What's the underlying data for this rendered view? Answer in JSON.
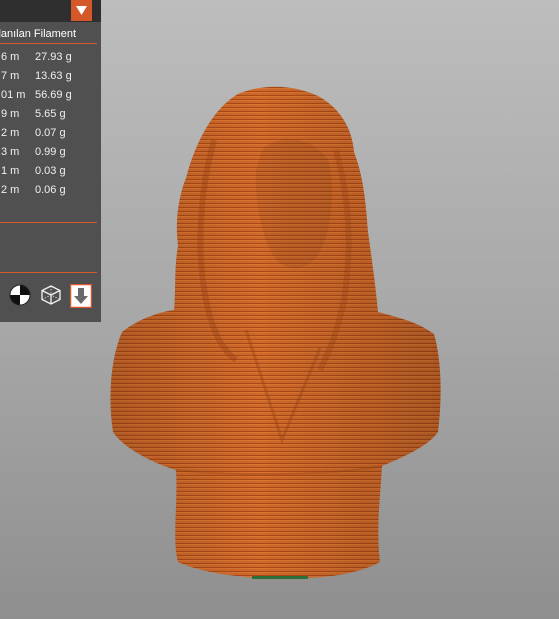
{
  "panel": {
    "header": "llanılan Filament",
    "rows": [
      {
        "length": "6 m",
        "weight": "27.93 g"
      },
      {
        "length": "7 m",
        "weight": "13.63 g"
      },
      {
        "length": "01 m",
        "weight": "56.69 g"
      },
      {
        "length": "9 m",
        "weight": "5.65 g"
      },
      {
        "length": "2 m",
        "weight": "0.07 g"
      },
      {
        "length": "3 m",
        "weight": "0.99 g"
      },
      {
        "length": "1 m",
        "weight": "0.03 g"
      },
      {
        "length": "2 m",
        "weight": "0.06 g"
      }
    ],
    "tools": [
      "center-of-mass-icon",
      "wireframe-cube-icon",
      "extruder-download-icon"
    ]
  },
  "colors": {
    "accent": "#d4582a",
    "panel_bg": "#505050",
    "model": "#cf6828",
    "model_line": "#a84a18",
    "background_top": "#bdbdbd",
    "background_bottom": "#8f8f8f"
  }
}
